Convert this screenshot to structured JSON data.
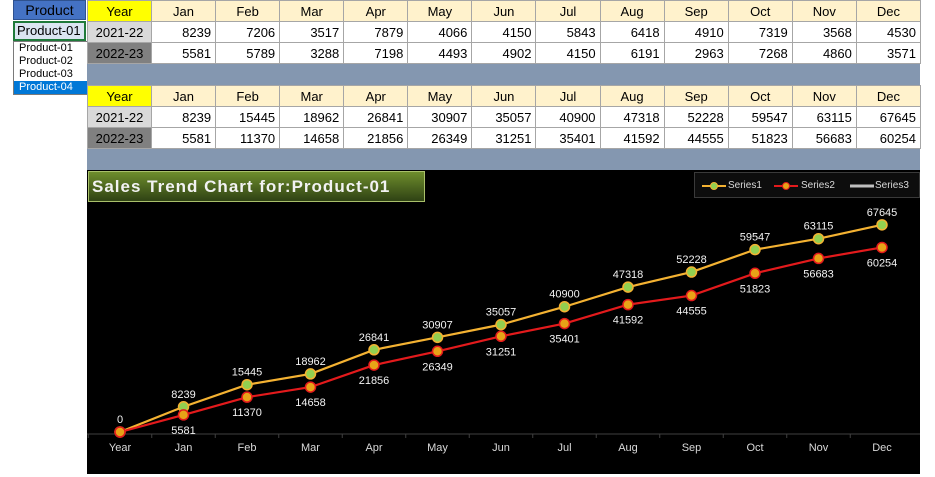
{
  "product_picker": {
    "header": "Product",
    "selected": "Product-01",
    "dropdown_glyph": "▼",
    "options": [
      "Product-01",
      "Product-02",
      "Product-03",
      "Product-04"
    ],
    "highlighted_option": "Product-04"
  },
  "table1": {
    "header": [
      "Year",
      "Jan",
      "Feb",
      "Mar",
      "Apr",
      "May",
      "Jun",
      "Jul",
      "Aug",
      "Sep",
      "Oct",
      "Nov",
      "Dec"
    ],
    "rows": [
      {
        "label": "2021-22",
        "values": [
          "8239",
          "7206",
          "3517",
          "7879",
          "4066",
          "4150",
          "5843",
          "6418",
          "4910",
          "7319",
          "3568",
          "4530"
        ]
      },
      {
        "label": "2022-23",
        "values": [
          "5581",
          "5789",
          "3288",
          "7198",
          "4493",
          "4902",
          "4150",
          "6191",
          "2963",
          "7268",
          "4860",
          "3571"
        ]
      }
    ]
  },
  "table2": {
    "header": [
      "Year",
      "Jan",
      "Feb",
      "Mar",
      "Apr",
      "May",
      "Jun",
      "Jul",
      "Aug",
      "Sep",
      "Oct",
      "Nov",
      "Dec"
    ],
    "rows": [
      {
        "label": "2021-22",
        "values": [
          "8239",
          "15445",
          "18962",
          "26841",
          "30907",
          "35057",
          "40900",
          "47318",
          "52228",
          "59547",
          "63115",
          "67645"
        ]
      },
      {
        "label": "2022-23",
        "values": [
          "5581",
          "11370",
          "14658",
          "21856",
          "26349",
          "31251",
          "35401",
          "41592",
          "44555",
          "51823",
          "56683",
          "60254"
        ]
      }
    ]
  },
  "chart_title": "Sales Trend Chart for:Product-01",
  "colors": {
    "series1": "#f4b232",
    "series2": "#e31a1c",
    "series3": "#bfbfbf",
    "marker1": "#92d050",
    "marker2": "#e8a317"
  },
  "chart_data": {
    "type": "line",
    "title": "Sales Trend Chart for:Product-01",
    "categories": [
      "Year",
      "Jan",
      "Feb",
      "Mar",
      "Apr",
      "May",
      "Jun",
      "Jul",
      "Aug",
      "Sep",
      "Oct",
      "Nov",
      "Dec"
    ],
    "series": [
      {
        "name": "Series1",
        "values": [
          0,
          8239,
          15445,
          18962,
          26841,
          30907,
          35057,
          40900,
          47318,
          52228,
          59547,
          63115,
          67645
        ]
      },
      {
        "name": "Series2",
        "values": [
          0,
          5581,
          11370,
          14658,
          21856,
          26349,
          31251,
          35401,
          41592,
          44555,
          51823,
          56683,
          60254
        ]
      },
      {
        "name": "Series3",
        "values": []
      }
    ],
    "ylim": [
      0,
      80000
    ],
    "grid": false,
    "legend": "top-right"
  }
}
